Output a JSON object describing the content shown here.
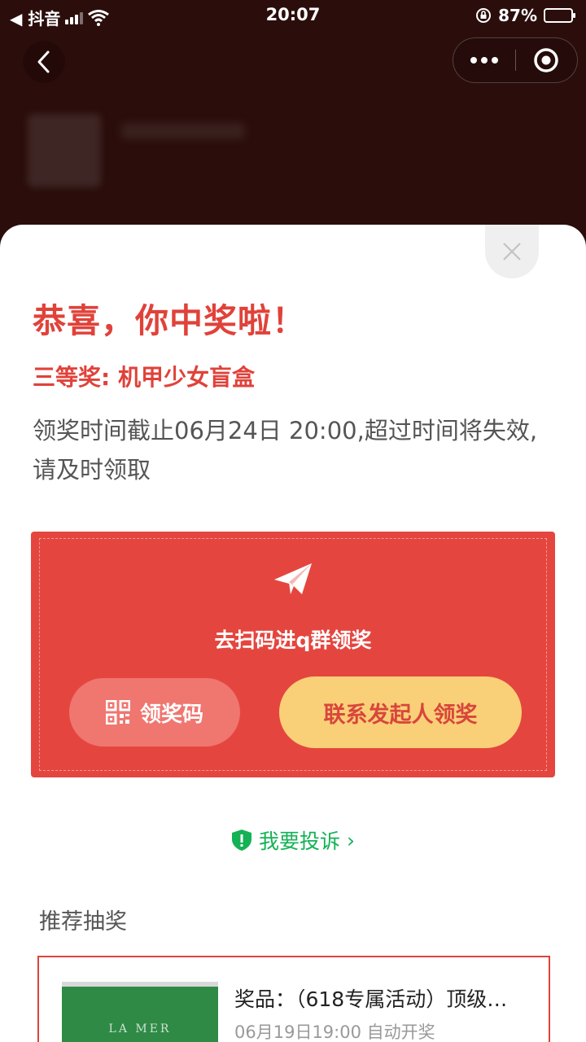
{
  "status_bar": {
    "back_app": "◀ 抖音",
    "time": "20:07",
    "battery": "87%"
  },
  "sheet": {
    "title": "恭喜，你中奖啦！",
    "prize": "三等奖: 机甲少女盲盒",
    "deadline": "领奖时间截止06月24日 20:00,超过时间将失效,请及时领取"
  },
  "red_card": {
    "scan_text": "去扫码进q群领奖",
    "code_button": "领奖码",
    "contact_button": "联系发起人领奖"
  },
  "complain": {
    "label": "我要投诉",
    "chevron": "›"
  },
  "recommend": {
    "title": "推荐抽奖",
    "item": {
      "name": "奖品：（618专属活动）顶级…",
      "sub": "06月19日19:00 自动开奖",
      "brand": "LA MER"
    }
  },
  "colors": {
    "accent_red": "#e0423a",
    "button_yellow": "#f9d078",
    "complain_green": "#14b255"
  },
  "icons": [
    "back-chevron-icon",
    "more-dots-icon",
    "target-icon",
    "close-icon",
    "paper-plane-icon",
    "qr-code-icon",
    "shield-icon"
  ]
}
